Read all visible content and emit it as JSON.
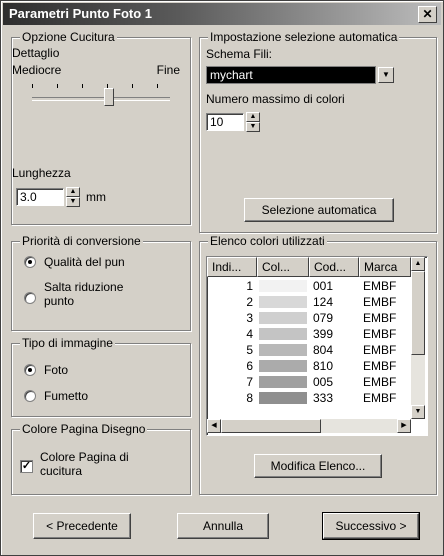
{
  "window": {
    "title": "Parametri Punto Foto 1",
    "close_glyph": "✕"
  },
  "stitch_option": {
    "legend": "Opzione Cucitura",
    "detail_label": "Dettaglio",
    "left_label": "Mediocre",
    "right_label": "Fine",
    "slider_value": 0.55,
    "length_label": "Lunghezza",
    "length_value": "3.0",
    "unit": "mm"
  },
  "auto_selection": {
    "legend": "Impostazione selezione automatica",
    "scheme_label": "Schema Fili:",
    "scheme_value": "mychart",
    "max_colors_label": "Numero massimo di colori",
    "max_colors_value": "10",
    "button": "Selezione automatica"
  },
  "priority": {
    "legend": "Priorità di conversione",
    "options": [
      "Qualità del pun",
      "Salta riduzione\npunto"
    ],
    "selected": 0
  },
  "image_type": {
    "legend": "Tipo di immagine",
    "options": [
      "Foto",
      "Fumetto"
    ],
    "selected": 0
  },
  "page_color": {
    "legend": "Colore Pagina Disegno",
    "checkbox_label": "Colore Pagina di\ncucitura",
    "checked": true
  },
  "color_list": {
    "legend": "Elenco colori utilizzati",
    "headers": [
      "Indi...",
      "Col...",
      "Cod...",
      "Marca"
    ],
    "rows": [
      {
        "index": "1",
        "code": "001",
        "brand": "EMBF",
        "swatch": "#f2f2f2"
      },
      {
        "index": "2",
        "code": "124",
        "brand": "EMBF",
        "swatch": "#d8d8d8"
      },
      {
        "index": "3",
        "code": "079",
        "brand": "EMBF",
        "swatch": "#cfcfcf"
      },
      {
        "index": "4",
        "code": "399",
        "brand": "EMBF",
        "swatch": "#c4c4c4"
      },
      {
        "index": "5",
        "code": "804",
        "brand": "EMBF",
        "swatch": "#b8b8b8"
      },
      {
        "index": "6",
        "code": "810",
        "brand": "EMBF",
        "swatch": "#ababab"
      },
      {
        "index": "7",
        "code": "005",
        "brand": "EMBF",
        "swatch": "#a0a0a0"
      },
      {
        "index": "8",
        "code": "333",
        "brand": "EMBF",
        "swatch": "#8f8f8f"
      }
    ],
    "modify_button": "Modifica Elenco..."
  },
  "footer": {
    "back": "< Precedente",
    "cancel": "Annulla",
    "next": "Successivo >"
  }
}
